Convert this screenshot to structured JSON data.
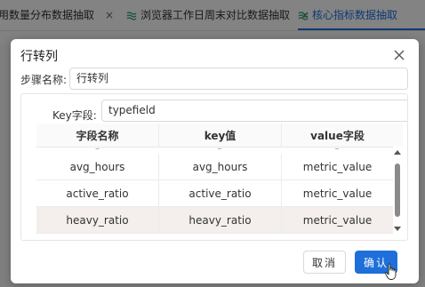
{
  "background": {
    "tabs": [
      {
        "label": "用数量分布数据抽取",
        "active": false
      },
      {
        "label": "浏览器工作日周末对比数据抽取",
        "active": false
      },
      {
        "label": "核心指标数据抽取",
        "active": true
      }
    ],
    "close_glyph": "×"
  },
  "dialog": {
    "title": "行转列",
    "step_name_label": "步骤名称:",
    "step_name_value": "行转列",
    "key_field_label": "Key字段:",
    "key_field_value": "typefield",
    "table": {
      "columns": [
        "字段名称",
        "key值",
        "value字段"
      ],
      "partial_row": [
        "–",
        "–",
        "–"
      ],
      "rows": [
        [
          "avg_hours",
          "avg_hours",
          "metric_value"
        ],
        [
          "active_ratio",
          "active_ratio",
          "metric_value"
        ],
        [
          "heavy_ratio",
          "heavy_ratio",
          "metric_value"
        ]
      ],
      "selected_row_index": 2,
      "scroll_position": 0.5
    },
    "cancel_label": "取消",
    "ok_label": "确认"
  },
  "colors": {
    "accent": "#1e6fd9",
    "selected_row": "#f4efec",
    "overlay": "rgba(0,0,0,0.48)"
  },
  "icons": [
    "doc-icon",
    "close-icon",
    "chevron-up-icon",
    "chevron-down-icon",
    "hand-cursor-icon"
  ]
}
